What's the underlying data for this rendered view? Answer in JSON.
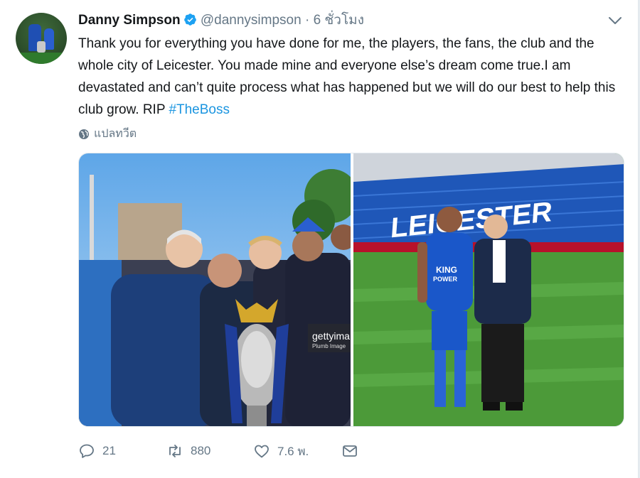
{
  "tweet": {
    "author_name": "Danny Simpson",
    "handle": "@dannysimpson",
    "separator": "·",
    "time": "6 ชั่วโมง",
    "text_main": "Thank you for everything you have done for me, the players, the fans, the club and the whole city of Leicester. You made mine and everyone else’s dream come true.I am devastated and can’t quite process what has happened but we will do our best to help this club grow. RIP ",
    "hashtag": "#TheBoss",
    "translate_label": "แปลทวีต",
    "image_watermark": "gettyima",
    "image_watermark_sub": "Plumb Image",
    "shirt_text_1": "KING",
    "shirt_text_2": "POWER",
    "stadium_text": "LEICESTER"
  },
  "actions": {
    "replies": "21",
    "retweets": "880",
    "likes": "7.6 พ."
  },
  "colors": {
    "link": "#1b95e0",
    "muted": "#657786",
    "verified": "#1da1f2"
  },
  "icons": [
    "verified-badge-icon",
    "chevron-down-icon",
    "globe-icon",
    "reply-icon",
    "retweet-icon",
    "like-icon",
    "message-icon"
  ]
}
